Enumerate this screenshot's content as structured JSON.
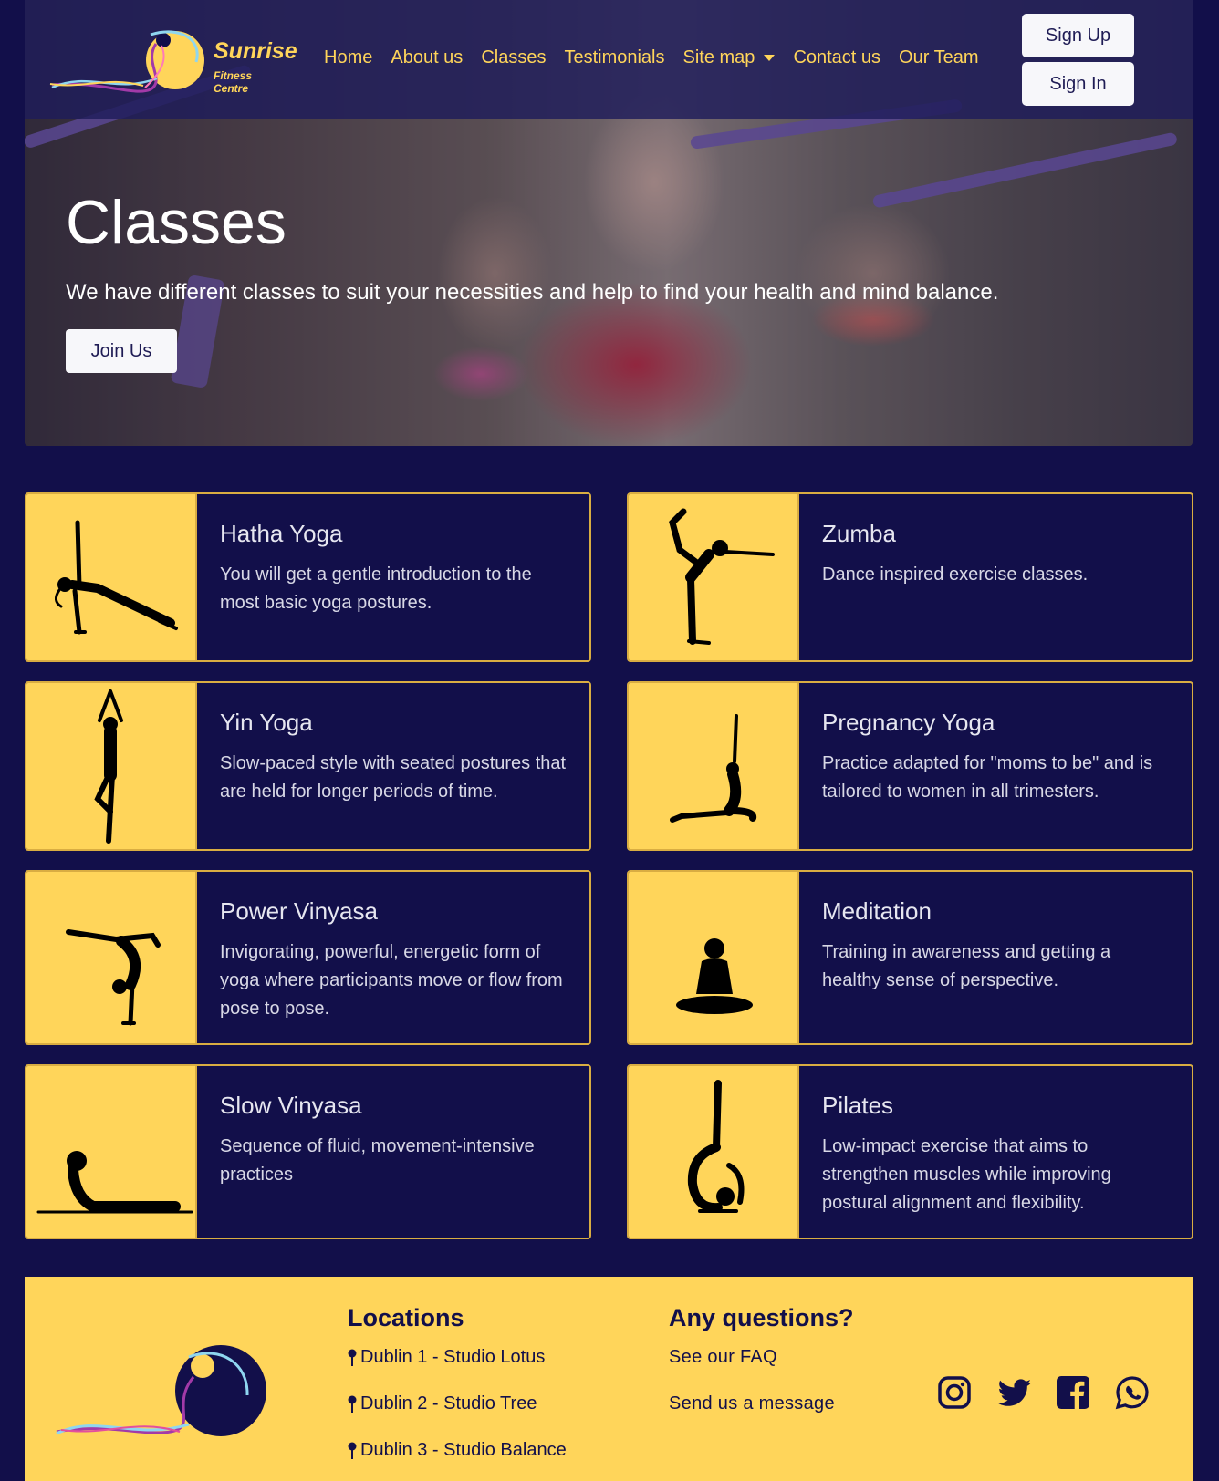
{
  "brand": {
    "name": "Sunrise",
    "tagline": "Fitness Centre"
  },
  "nav": {
    "items": [
      "Home",
      "About us",
      "Classes",
      "Testimonials",
      "Site map",
      "Contact us",
      "Our Team"
    ],
    "sign_up": "Sign Up",
    "sign_in": "Sign In"
  },
  "hero": {
    "title": "Classes",
    "subtitle": "We have different classes to suit your necessities and help to find your health and mind balance.",
    "cta": "Join Us"
  },
  "classes": [
    {
      "title": "Hatha Yoga",
      "text": "You will get a gentle introduction to the most basic yoga postures.",
      "icon": "side-plank-icon"
    },
    {
      "title": "Zumba",
      "text": "Dance inspired exercise classes.",
      "icon": "dancer-pose-icon"
    },
    {
      "title": "Yin Yoga",
      "text": "Slow-paced style with seated postures that are held for longer periods of time.",
      "icon": "tree-pose-icon"
    },
    {
      "title": "Pregnancy Yoga",
      "text": "Practice adapted for \"moms to be\" and is tailored to women in all trimesters.",
      "icon": "pigeon-pose-icon"
    },
    {
      "title": "Power Vinyasa",
      "text": "Invigorating, powerful, energetic form of yoga where participants move or flow from pose to pose.",
      "icon": "handstand-pose-icon"
    },
    {
      "title": "Meditation",
      "text": "Training in awareness and getting a healthy sense of perspective.",
      "icon": "lotus-meditation-icon"
    },
    {
      "title": "Slow Vinyasa",
      "text": "Sequence of fluid, movement-intensive practices",
      "icon": "cobra-pose-icon"
    },
    {
      "title": "Pilates",
      "text": "Low-impact exercise that aims to strengthen muscles while improving postural alignment and flexibility.",
      "icon": "scorpion-pose-icon"
    }
  ],
  "footer": {
    "locations_title": "Locations",
    "locations": [
      "Dublin 1 - Studio Lotus",
      "Dublin 2 - Studio Tree",
      "Dublin 3 - Studio Balance"
    ],
    "questions_title": "Any questions?",
    "faq": "See our FAQ",
    "message": "Send us a message",
    "social": [
      "instagram-icon",
      "twitter-icon",
      "facebook-icon",
      "whatsapp-icon"
    ]
  },
  "colors": {
    "navy": "#120f4a",
    "yellow": "#ffd55a",
    "gold_border": "#d9ad42"
  }
}
